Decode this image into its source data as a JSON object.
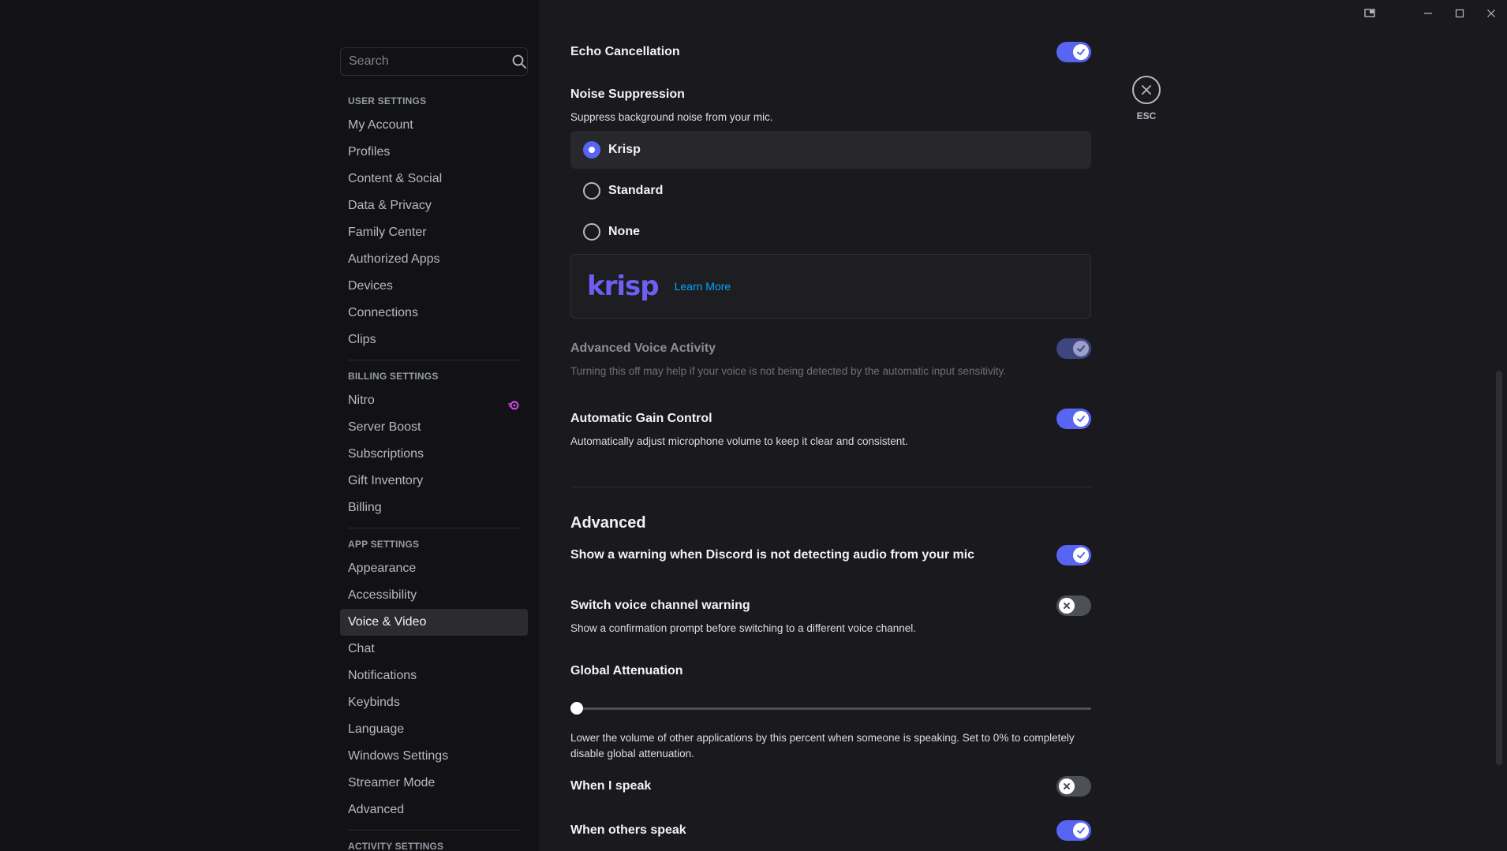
{
  "sidebar": {
    "search_placeholder": "Search",
    "user_settings": {
      "header": "USER SETTINGS",
      "items": [
        "My Account",
        "Profiles",
        "Content & Social",
        "Data & Privacy",
        "Family Center",
        "Authorized Apps",
        "Devices",
        "Connections",
        "Clips"
      ]
    },
    "billing_settings": {
      "header": "BILLING SETTINGS",
      "items": [
        "Nitro",
        "Server Boost",
        "Subscriptions",
        "Gift Inventory",
        "Billing"
      ]
    },
    "app_settings": {
      "header": "APP SETTINGS",
      "items": [
        "Appearance",
        "Accessibility",
        "Voice & Video",
        "Chat",
        "Notifications",
        "Keybinds",
        "Language",
        "Windows Settings",
        "Streamer Mode",
        "Advanced"
      ],
      "active": "Voice & Video"
    },
    "activity_settings": {
      "header": "ACTIVITY SETTINGS"
    }
  },
  "main": {
    "echo_cancellation": {
      "title": "Echo Cancellation",
      "enabled": true
    },
    "noise_suppression": {
      "title": "Noise Suppression",
      "desc": "Suppress background noise from your mic.",
      "options": [
        "Krisp",
        "Standard",
        "None"
      ],
      "selected": "Krisp",
      "krisp_logo": "krisp",
      "learn_more": "Learn More"
    },
    "advanced_voice_activity": {
      "title": "Advanced Voice Activity",
      "desc": "Turning this off may help if your voice is not being detected by the automatic input sensitivity.",
      "enabled": true,
      "disabled_state": true
    },
    "automatic_gain_control": {
      "title": "Automatic Gain Control",
      "desc": "Automatically adjust microphone volume to keep it clear and consistent.",
      "enabled": true
    },
    "advanced": {
      "heading": "Advanced",
      "mic_warning": {
        "title": "Show a warning when Discord is not detecting audio from your mic",
        "enabled": true
      },
      "switch_channel": {
        "title": "Switch voice channel warning",
        "desc": "Show a confirmation prompt before switching to a different voice channel.",
        "enabled": false
      },
      "global_attenuation": {
        "title": "Global Attenuation",
        "value_percent": 0,
        "desc": "Lower the volume of other applications by this percent when someone is speaking. Set to 0% to completely disable global attenuation."
      },
      "when_i_speak": {
        "title": "When I speak",
        "enabled": false
      },
      "when_others_speak": {
        "title": "When others speak",
        "enabled": true
      }
    },
    "close": {
      "label": "ESC"
    }
  },
  "colors": {
    "accent": "#5865f2",
    "sidebar_bg": "#121214",
    "main_bg": "#1a1a1e",
    "link": "#00a8fc",
    "krisp": "#6e5ef2"
  }
}
